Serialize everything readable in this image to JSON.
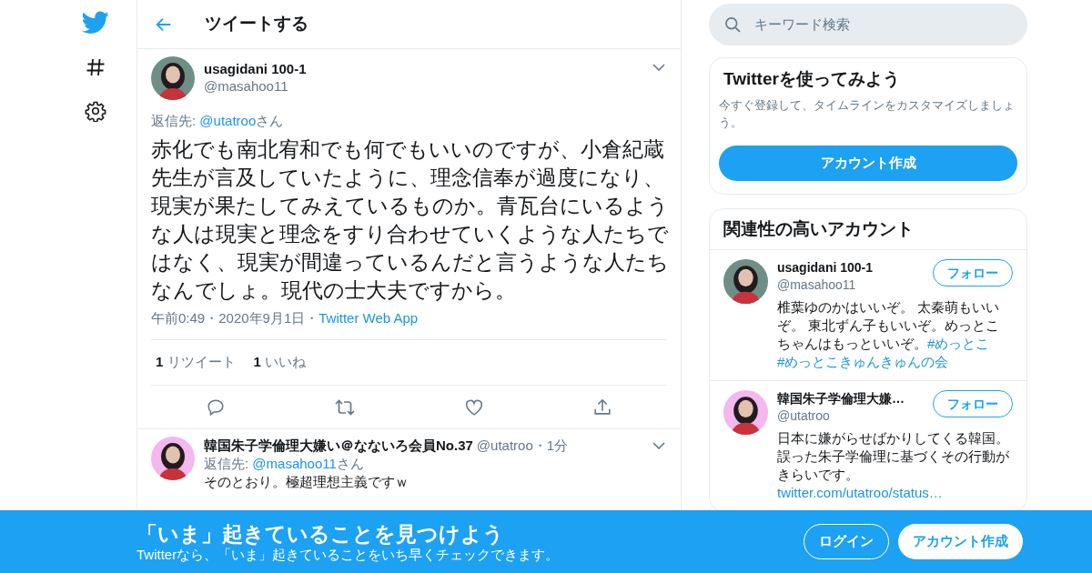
{
  "search": {
    "placeholder": "キーワード検索"
  },
  "header": {
    "title": "ツイートする"
  },
  "tweet": {
    "name": "usagidani 100-1",
    "handle": "@masahoo11",
    "color": "#6f8f86",
    "reply_to": {
      "label": "返信先: ",
      "handle": "@utatroo",
      "suffix": "さん"
    },
    "text": "赤化でも南北宥和でも何でもいいのですが、小倉紀蔵先生が言及していたように、理念信奉が過度になり、現実が果たしてみえているものか。青瓦台にいるような人は現実と理念をすり合わせていくような人たちではなく、現実が間違っているんだと言うような人たちなんでしょ。現代の士大夫ですから。",
    "meta": [
      {
        "kind": "text",
        "text": "午前0:49"
      },
      {
        "kind": "sep",
        "text": "・"
      },
      {
        "kind": "text",
        "text": "2020年9月1日"
      },
      {
        "kind": "sep",
        "text": "・"
      },
      {
        "kind": "link",
        "text": "Twitter Web App"
      }
    ],
    "stats": [
      {
        "count": "1",
        "label": "リツイート"
      },
      {
        "count": "1",
        "label": "いいね"
      }
    ]
  },
  "reply": {
    "name": "韓国朱子学倫理大嫌い＠なないろ会員No.37",
    "handle": "@utatroo",
    "sep": "・",
    "time": "1分",
    "color": "#f3b8ee",
    "reply_to": {
      "label": "返信先: ",
      "handle": "@masahoo11",
      "suffix": "さん"
    },
    "text": "そのとおり。極超理想主義ですｗ"
  },
  "signup_card": {
    "title": "Twitterを使ってみよう",
    "text": "今すぐ登録して、タイムラインをカスタマイズしましょう。",
    "button": "アカウント作成"
  },
  "related": {
    "title": "関連性の高いアカウント",
    "accounts": [
      {
        "name": "usagidani 100-1",
        "handle": "@masahoo11",
        "color": "#6f8f86",
        "button": "フォロー",
        "bio": [
          {
            "kind": "text",
            "text": "椎葉ゆのかはいいぞ。 太秦萌もいいぞ。 東北ずん子もいいぞ。めっとこちゃんはもっといいぞ。"
          },
          {
            "kind": "link",
            "text": "#めっとこ"
          },
          {
            "kind": "link",
            "text": "#めっとこきゅんきゅんの会"
          }
        ]
      },
      {
        "name": "韓国朱子学倫理大嫌…",
        "handle": "@utatroo",
        "color": "#f3b8ee",
        "button": "フォロー",
        "bio": [
          {
            "kind": "text",
            "text": "日本に嫌がらせばかりしてくる韓国。誤った朱子学倫理に基づくその行動がきらいです。 "
          },
          {
            "kind": "link",
            "text": "twitter.com/utatroo/status…"
          }
        ]
      }
    ]
  },
  "banner": {
    "title": "「いま」起きていることを見つけよう",
    "subtitle": "Twitterなら、「いま」起きていることをいち早くチェックできます。",
    "buttons": [
      {
        "kind": "outline",
        "label": "ログイン"
      },
      {
        "kind": "solid",
        "label": "アカウント作成"
      }
    ]
  }
}
